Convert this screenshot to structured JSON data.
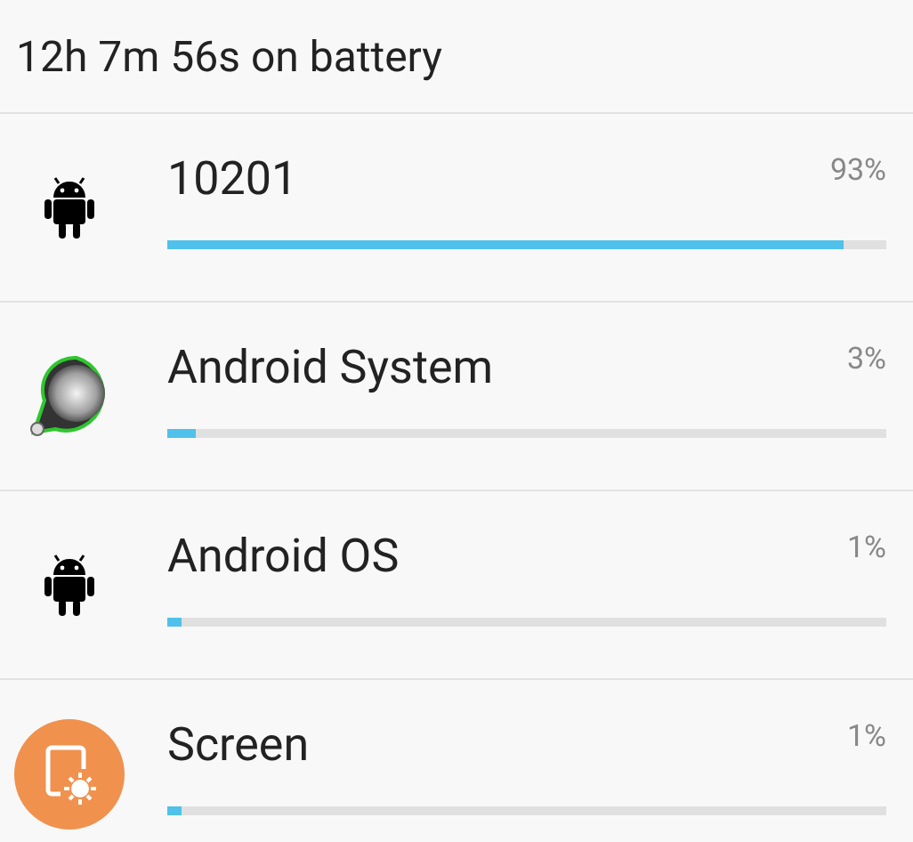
{
  "header": {
    "title": "12h 7m 56s on battery"
  },
  "apps": [
    {
      "kind": "android",
      "name": "10201",
      "percent": "93%",
      "level": 0.94
    },
    {
      "kind": "system",
      "name": "Android System",
      "percent": "3%",
      "level": 0.04
    },
    {
      "kind": "android",
      "name": "Android OS",
      "percent": "1%",
      "level": 0.02
    },
    {
      "kind": "screen",
      "name": "Screen",
      "percent": "1%",
      "level": 0.02
    }
  ]
}
